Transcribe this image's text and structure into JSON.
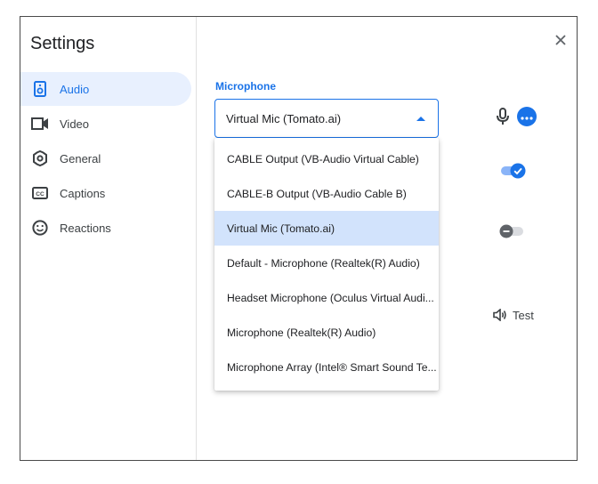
{
  "dialog": {
    "title": "Settings"
  },
  "sidebar": {
    "items": [
      {
        "label": "Audio",
        "icon": "speaker-icon",
        "active": true
      },
      {
        "label": "Video",
        "icon": "video-camera-icon",
        "active": false
      },
      {
        "label": "General",
        "icon": "gear-icon",
        "active": false
      },
      {
        "label": "Captions",
        "icon": "cc-icon",
        "active": false
      },
      {
        "label": "Reactions",
        "icon": "smiley-icon",
        "active": false
      }
    ]
  },
  "audio": {
    "microphone_label": "Microphone",
    "microphone_selected": "Virtual Mic (Tomato.ai)",
    "microphone_options": [
      "CABLE Output (VB-Audio Virtual Cable)",
      "CABLE-B Output (VB-Audio Cable B)",
      "Virtual Mic (Tomato.ai)",
      "Default - Microphone (Realtek(R) Audio)",
      "Headset Microphone (Oculus Virtual Audi...",
      "Microphone (Realtek(R) Audio)",
      "Microphone Array (Intel® Smart Sound Te..."
    ],
    "toggle_1": {
      "on": true
    },
    "toggle_2": {
      "on": false
    },
    "test_label": "Test"
  },
  "colors": {
    "accent": "#1a73e8",
    "active_bg": "#e8f0fe",
    "selected_option_bg": "#d2e3fc"
  }
}
